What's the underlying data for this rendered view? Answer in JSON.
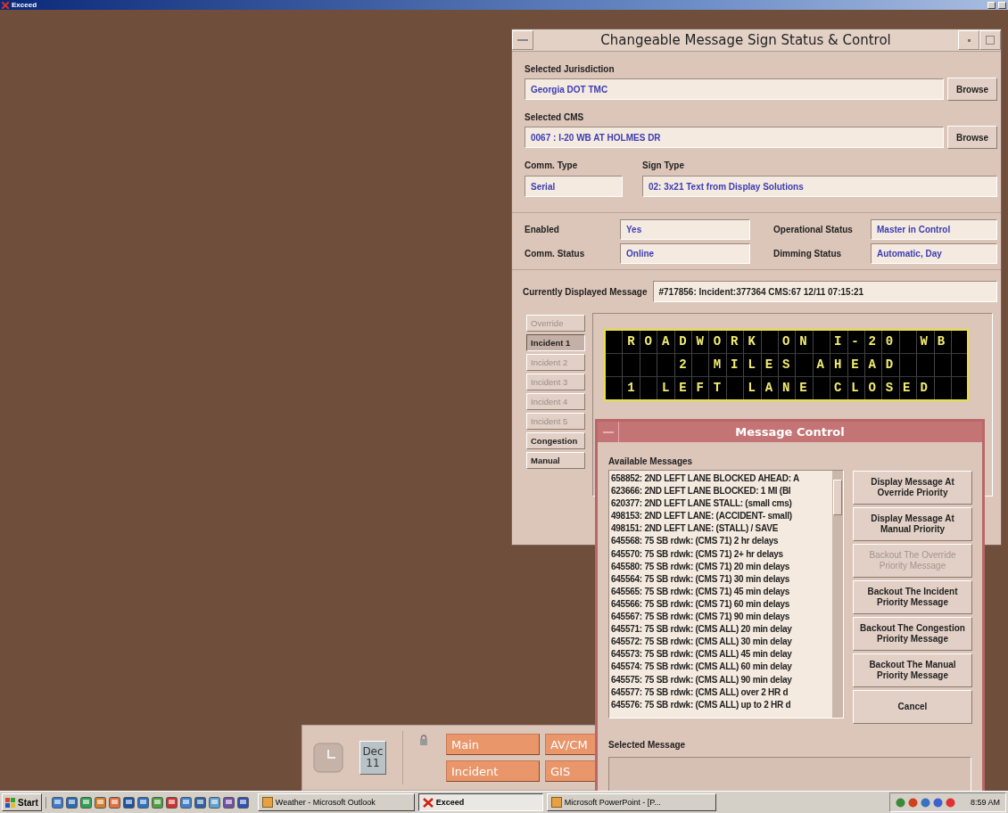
{
  "app_bar": {
    "title": "Exceed"
  },
  "cms_window": {
    "title": "Changeable Message Sign Status & Control",
    "jurisdiction": {
      "label": "Selected Jurisdiction",
      "value": "Georgia DOT TMC",
      "button": "Browse"
    },
    "cms": {
      "label": "Selected CMS",
      "value": "0067 : I-20 WB AT HOLMES DR",
      "button": "Browse"
    },
    "comm_type": {
      "label": "Comm. Type",
      "value": "Serial"
    },
    "sign_type": {
      "label": "Sign Type",
      "value": "02: 3x21 Text from Display Solutions"
    },
    "status": [
      {
        "label": "Enabled",
        "value": "Yes"
      },
      {
        "label": "Operational Status",
        "value": "Master in Control"
      },
      {
        "label": "Comm. Status",
        "value": "Online"
      },
      {
        "label": "Dimming Status",
        "value": "Automatic, Day"
      }
    ],
    "current_message": {
      "label": "Currently Displayed Message",
      "value": "#717856:  Incident:377364 CMS:67 12/11 07:15:21"
    },
    "priorities": [
      {
        "label": "Override",
        "selected": false,
        "disabled": true
      },
      {
        "label": "Incident 1",
        "selected": true,
        "disabled": false
      },
      {
        "label": "Incident 2",
        "selected": false,
        "disabled": true
      },
      {
        "label": "Incident 3",
        "selected": false,
        "disabled": true
      },
      {
        "label": "Incident 4",
        "selected": false,
        "disabled": true
      },
      {
        "label": "Incident 5",
        "selected": false,
        "disabled": true
      },
      {
        "label": "Congestion",
        "selected": false,
        "disabled": false
      },
      {
        "label": "Manual",
        "selected": false,
        "disabled": false
      }
    ],
    "sign_rows": [
      " ROADWORK ON I-20 WB ",
      "    2 MILES AHEAD    ",
      " 1 LEFT LANE CLOSED  "
    ]
  },
  "message_dialog": {
    "title": "Message Control",
    "available_label": "Available Messages",
    "messages": [
      "658852: 2ND LEFT LANE BLOCKED AHEAD: A",
      "623666: 2ND LEFT LANE BLOCKED: 1 MI (BI",
      "620377: 2ND LEFT LANE STALL: (small cms)",
      "498153: 2ND LEFT LANE: (ACCIDENT- small)",
      "498151: 2ND LEFT LANE: (STALL) / SAVE",
      "645568: 75 SB rdwk: (CMS 71) 2 hr delays",
      "645570: 75 SB rdwk: (CMS 71) 2+ hr delays",
      "645580: 75 SB rdwk: (CMS 71) 20 min delays",
      "645564: 75 SB rdwk: (CMS 71) 30 min delays",
      "645565: 75 SB rdwk: (CMS 71) 45 min delays",
      "645566: 75 SB rdwk: (CMS 71) 60 min delays",
      "645567: 75 SB rdwk: (CMS 71) 90 min delays",
      "645571: 75 SB rdwk: (CMS ALL) 20 min delay",
      "645572: 75 SB rdwk: (CMS ALL) 30 min delay",
      "645573: 75 SB rdwk: (CMS ALL) 45 min delay",
      "645574: 75 SB rdwk: (CMS ALL) 60 min delay",
      "645575: 75 SB rdwk: (CMS ALL) 90 min delay",
      "645577: 75 SB rdwk: (CMS ALL) over 2 HR d",
      "645576: 75 SB rdwk: (CMS ALL) up to 2 HR d"
    ],
    "buttons": [
      {
        "label": "Display Message At Override Priority",
        "disabled": false
      },
      {
        "label": "Display Message At Manual Priority",
        "disabled": false
      },
      {
        "label": "Backout The Override Priority Message",
        "disabled": true
      },
      {
        "label": "Backout The Incident Priority Message",
        "disabled": false
      },
      {
        "label": "Backout The Congestion Priority Message",
        "disabled": false
      },
      {
        "label": "Backout The Manual Priority Message",
        "disabled": false
      },
      {
        "label": "Cancel",
        "disabled": false
      }
    ],
    "selected_label": "Selected Message"
  },
  "launch_panel": {
    "month": "Dec",
    "day": "11",
    "buttons": [
      "Main",
      "AV/CM",
      "Incident",
      "GIS"
    ]
  },
  "taskbar": {
    "start": "Start",
    "tasks": [
      {
        "label": "Weather - Microsoft Outlook",
        "selected": false
      },
      {
        "label": "Exceed",
        "selected": true
      },
      {
        "label": "Microsoft PowerPoint - [P...",
        "selected": false
      }
    ],
    "clock": "8:59 AM"
  }
}
